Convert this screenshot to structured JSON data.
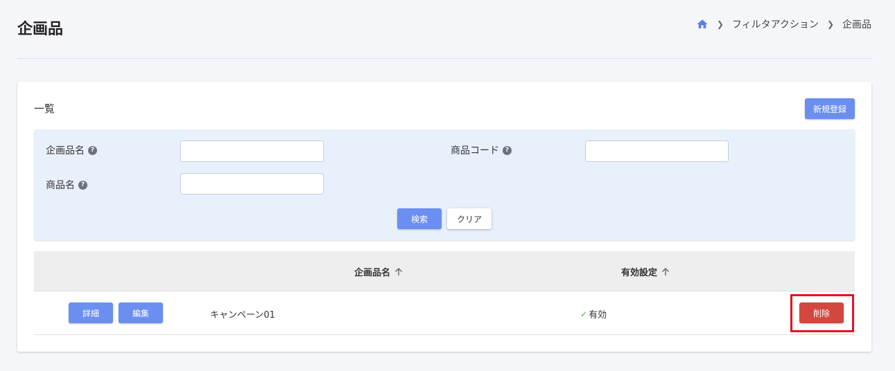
{
  "header": {
    "title": "企画品",
    "breadcrumb": [
      {
        "icon": "home-icon"
      },
      {
        "label": "フィルタアクション"
      },
      {
        "label": "企画品"
      }
    ]
  },
  "card": {
    "title": "一覧",
    "new_button_label": "新規登録"
  },
  "filter": {
    "fields": [
      {
        "label": "企画品名",
        "value": "",
        "placeholder": ""
      },
      {
        "label": "商品コード",
        "value": "",
        "placeholder": ""
      },
      {
        "label": "商品名",
        "value": "",
        "placeholder": ""
      }
    ],
    "search_label": "検索",
    "clear_label": "クリア"
  },
  "table": {
    "columns": [
      {
        "label": "企画品名",
        "sort": "asc"
      },
      {
        "label": "有効設定",
        "sort": "asc"
      }
    ],
    "rows": [
      {
        "detail_label": "詳細",
        "edit_label": "編集",
        "name": "キャンペーン01",
        "status": "有効",
        "delete_label": "削除"
      }
    ]
  },
  "colors": {
    "primary": "#6b8ff0",
    "danger": "#d2473e",
    "highlight": "#e4131d",
    "filter_bg": "#e8f0fb"
  }
}
